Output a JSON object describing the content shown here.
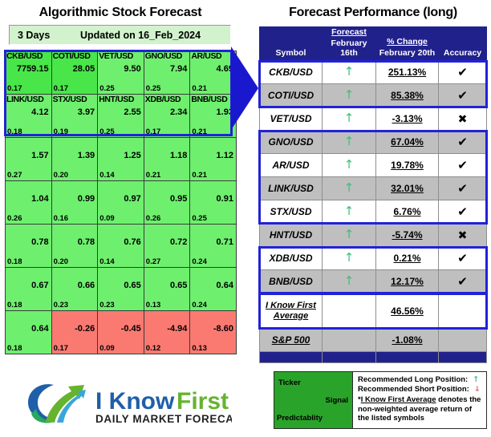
{
  "left": {
    "title": "Algorithmic Stock Forecast",
    "horizon": "3 Days",
    "updated": "Updated on 16_Feb_2024",
    "rows": [
      [
        {
          "symbol": "CKB/USD",
          "value": "7759.15",
          "pred": "0.17",
          "color": "brightgreen"
        },
        {
          "symbol": "COTI/USD",
          "value": "28.05",
          "pred": "0.17",
          "color": "brightgreen"
        },
        {
          "symbol": "VET/USD",
          "value": "9.50",
          "pred": "0.25",
          "color": "green"
        },
        {
          "symbol": "GNO/USD",
          "value": "7.94",
          "pred": "0.25",
          "color": "green"
        },
        {
          "symbol": "AR/USD",
          "value": "4.69",
          "pred": "0.21",
          "color": "green"
        }
      ],
      [
        {
          "symbol": "LINK/USD",
          "value": "4.12",
          "pred": "0.18",
          "color": "green"
        },
        {
          "symbol": "STX/USD",
          "value": "3.97",
          "pred": "0.19",
          "color": "green"
        },
        {
          "symbol": "HNT/USD",
          "value": "2.55",
          "pred": "0.25",
          "color": "green"
        },
        {
          "symbol": "XDB/USD",
          "value": "2.34",
          "pred": "0.17",
          "color": "green"
        },
        {
          "symbol": "BNB/USD",
          "value": "1.93",
          "pred": "0.21",
          "color": "green"
        }
      ],
      [
        {
          "symbol": "",
          "value": "1.57",
          "pred": "0.27",
          "color": "green"
        },
        {
          "symbol": "",
          "value": "1.39",
          "pred": "0.20",
          "color": "green"
        },
        {
          "symbol": "",
          "value": "1.25",
          "pred": "0.14",
          "color": "green"
        },
        {
          "symbol": "",
          "value": "1.18",
          "pred": "0.21",
          "color": "green"
        },
        {
          "symbol": "",
          "value": "1.12",
          "pred": "0.21",
          "color": "green"
        }
      ],
      [
        {
          "symbol": "",
          "value": "1.04",
          "pred": "0.26",
          "color": "green"
        },
        {
          "symbol": "",
          "value": "0.99",
          "pred": "0.16",
          "color": "green"
        },
        {
          "symbol": "",
          "value": "0.97",
          "pred": "0.09",
          "color": "green"
        },
        {
          "symbol": "",
          "value": "0.95",
          "pred": "0.26",
          "color": "green"
        },
        {
          "symbol": "",
          "value": "0.91",
          "pred": "0.25",
          "color": "green"
        }
      ],
      [
        {
          "symbol": "",
          "value": "0.78",
          "pred": "0.18",
          "color": "green"
        },
        {
          "symbol": "",
          "value": "0.78",
          "pred": "0.20",
          "color": "green"
        },
        {
          "symbol": "",
          "value": "0.76",
          "pred": "0.14",
          "color": "green"
        },
        {
          "symbol": "",
          "value": "0.72",
          "pred": "0.27",
          "color": "green"
        },
        {
          "symbol": "",
          "value": "0.71",
          "pred": "0.24",
          "color": "green"
        }
      ],
      [
        {
          "symbol": "",
          "value": "0.67",
          "pred": "0.18",
          "color": "green"
        },
        {
          "symbol": "",
          "value": "0.66",
          "pred": "0.23",
          "color": "green"
        },
        {
          "symbol": "",
          "value": "0.65",
          "pred": "0.23",
          "color": "green"
        },
        {
          "symbol": "",
          "value": "0.65",
          "pred": "0.13",
          "color": "green"
        },
        {
          "symbol": "",
          "value": "0.64",
          "pred": "0.24",
          "color": "green"
        }
      ],
      [
        {
          "symbol": "",
          "value": "0.64",
          "pred": "0.18",
          "color": "green"
        },
        {
          "symbol": "",
          "value": "-0.26",
          "pred": "0.17",
          "color": "red"
        },
        {
          "symbol": "",
          "value": "-0.45",
          "pred": "0.09",
          "color": "red"
        },
        {
          "symbol": "",
          "value": "-4.94",
          "pred": "0.12",
          "color": "red"
        },
        {
          "symbol": "",
          "value": "-8.60",
          "pred": "0.13",
          "color": "red"
        }
      ]
    ]
  },
  "right": {
    "title": "Forecast Performance (long)",
    "header": {
      "symbol": "Symbol",
      "forecast_top": "Forecast",
      "forecast_sub": "February 16th",
      "change_top": "% Change",
      "change_sub": "February 20th",
      "accuracy": "Accuracy"
    },
    "rows": [
      {
        "symbol": "CKB/USD",
        "signal": "up-arrow-icon",
        "change": "251.13%",
        "accuracy": "check-icon",
        "shade": "white"
      },
      {
        "symbol": "COTI/USD",
        "signal": "up-arrow-icon",
        "change": "85.38%",
        "accuracy": "check-icon",
        "shade": "grey"
      },
      {
        "symbol": "VET/USD",
        "signal": "up-arrow-icon",
        "change": "-3.13%",
        "accuracy": "cross-icon",
        "shade": "white"
      },
      {
        "symbol": "GNO/USD",
        "signal": "up-arrow-icon",
        "change": "67.04%",
        "accuracy": "check-icon",
        "shade": "grey"
      },
      {
        "symbol": "AR/USD",
        "signal": "up-arrow-icon",
        "change": "19.78%",
        "accuracy": "check-icon",
        "shade": "white"
      },
      {
        "symbol": "LINK/USD",
        "signal": "up-arrow-icon",
        "change": "32.01%",
        "accuracy": "check-icon",
        "shade": "grey"
      },
      {
        "symbol": "STX/USD",
        "signal": "up-arrow-icon",
        "change": "6.76%",
        "accuracy": "check-icon",
        "shade": "white"
      },
      {
        "symbol": "HNT/USD",
        "signal": "up-arrow-icon",
        "change": "-5.74%",
        "accuracy": "cross-icon",
        "shade": "grey"
      },
      {
        "symbol": "XDB/USD",
        "signal": "up-arrow-icon",
        "change": "0.21%",
        "accuracy": "check-icon",
        "shade": "white"
      },
      {
        "symbol": "BNB/USD",
        "signal": "up-arrow-icon",
        "change": "12.17%",
        "accuracy": "check-icon",
        "shade": "grey"
      }
    ],
    "average_row": {
      "label_line1": "I Know First",
      "label_line2": "Average",
      "change": "46.56%"
    },
    "benchmark_row": {
      "label": "S&P 500",
      "change": "-1.08%"
    }
  },
  "legend": {
    "ticker": "Ticker",
    "signal": "Signal",
    "predictability": "Predictablity",
    "long_label": "Recommended Long Position:",
    "short_label": "Recommended Short Position:",
    "note_prefix": "*",
    "note_underlined": "I Know First Average",
    "note_rest": " denotes the non-weighted average return of the listed symbols"
  },
  "logo": {
    "word1": "I Know",
    "word2": "First",
    "tagline": "DAILY MARKET FORECAST",
    "blue": "#1f5fa9",
    "green": "#66b32e"
  },
  "icons": {
    "up_arrow": "↑",
    "down_arrow": "↓",
    "check": "✔",
    "cross": "✖"
  }
}
